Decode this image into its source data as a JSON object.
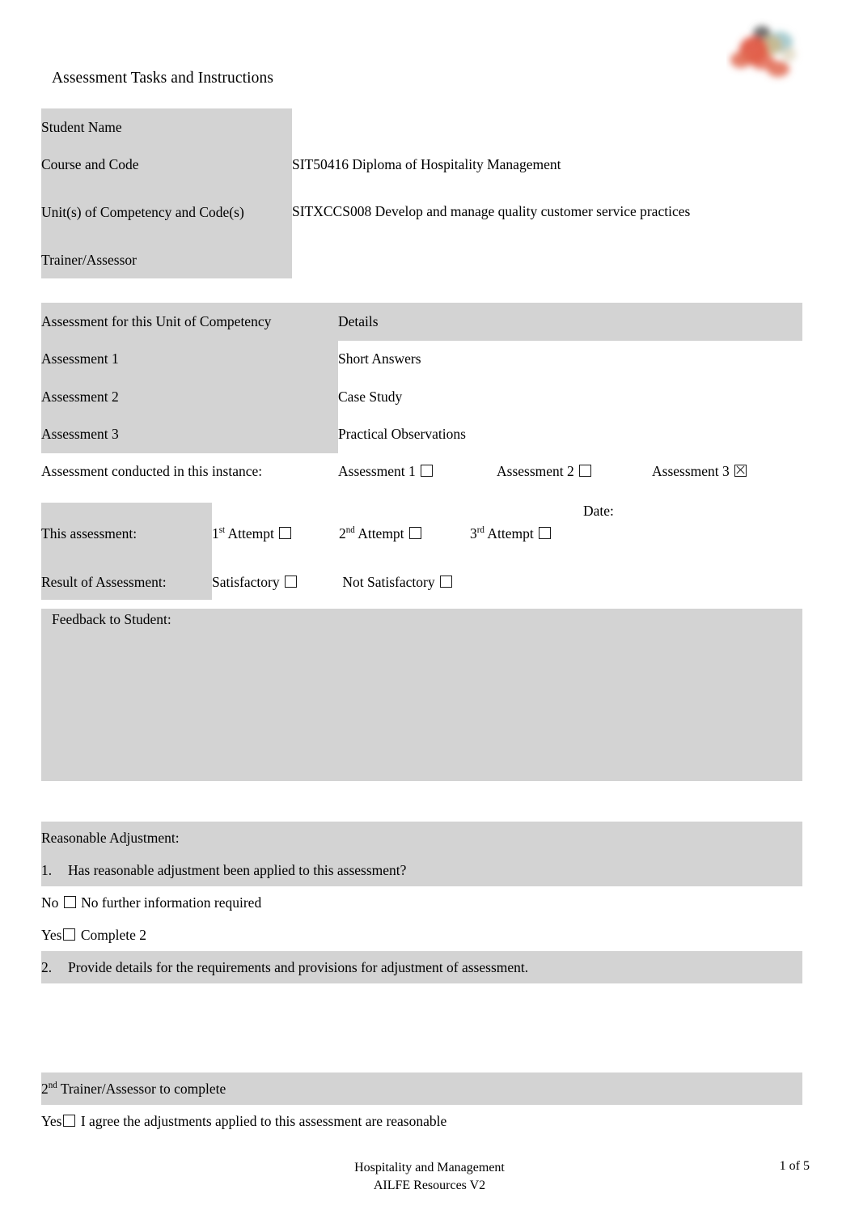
{
  "document": {
    "title": "Assessment Tasks and Instructions"
  },
  "logo": {
    "icon_name": "organisation-logo"
  },
  "student_details": {
    "rows": [
      {
        "label": "Student Name",
        "value": ""
      },
      {
        "label": "Course and Code",
        "value": "SIT50416 Diploma of Hospitality Management"
      },
      {
        "label": "Unit(s) of Competency and Code(s)",
        "value": "SITXCCS008 Develop and manage quality customer service practices"
      },
      {
        "label": "Trainer/Assessor",
        "value": ""
      }
    ]
  },
  "assessment_table": {
    "header": {
      "col1": "Assessment for this Unit of Competency",
      "col2": "Details"
    },
    "rows": [
      {
        "label": "Assessment 1",
        "detail": "Short Answers"
      },
      {
        "label": "Assessment 2",
        "detail": "Case Study"
      },
      {
        "label": "Assessment 3",
        "detail": "Practical Observations"
      }
    ],
    "conducted_label": "Assessment conducted in this instance:",
    "conducted_options": [
      {
        "label": "Assessment 1",
        "checked": false
      },
      {
        "label": "Assessment 2",
        "checked": false
      },
      {
        "label": "Assessment 3",
        "checked": true
      }
    ]
  },
  "result_table": {
    "this_assessment_label": "This assessment:",
    "attempts": [
      {
        "ordinal": "1",
        "suffix": "st",
        "label": "Attempt",
        "checked": false
      },
      {
        "ordinal": "2",
        "suffix": "nd",
        "label": "Attempt",
        "checked": false
      },
      {
        "ordinal": "3",
        "suffix": "rd",
        "label": "Attempt",
        "checked": false
      }
    ],
    "date_label": "Date:",
    "date_value": "",
    "result_label": "Result of Assessment:",
    "result_options": [
      {
        "label": "Satisfactory",
        "checked": false
      },
      {
        "label": "Not Satisfactory",
        "checked": false
      }
    ],
    "feedback_label": "Feedback to Student:",
    "feedback_value": ""
  },
  "reasonable_adjustment": {
    "heading": "Reasonable Adjustment:",
    "q1_number": "1.",
    "q1_text": "Has reasonable adjustment been applied to this assessment?",
    "no_label": "No",
    "no_text": "No further information required",
    "yes_label": "Yes",
    "yes_text": "Complete 2",
    "q2_number": "2.",
    "q2_text": "Provide details for the requirements and provisions for adjustment of assessment.",
    "details_value": "",
    "second_assessor_prefix": "2",
    "second_assessor_suffix": "nd",
    "second_assessor_text": "Trainer/Assessor to complete",
    "agree_label": "Yes",
    "agree_text": "I agree the adjustments applied to this assessment are reasonable"
  },
  "footer": {
    "line1": "Hospitality and Management",
    "line2": "AILFE Resources V2",
    "page": "1 of 5"
  },
  "colors": {
    "shaded_row": "#d3d3d3",
    "text": "#000000",
    "page_background": "#ffffff"
  }
}
